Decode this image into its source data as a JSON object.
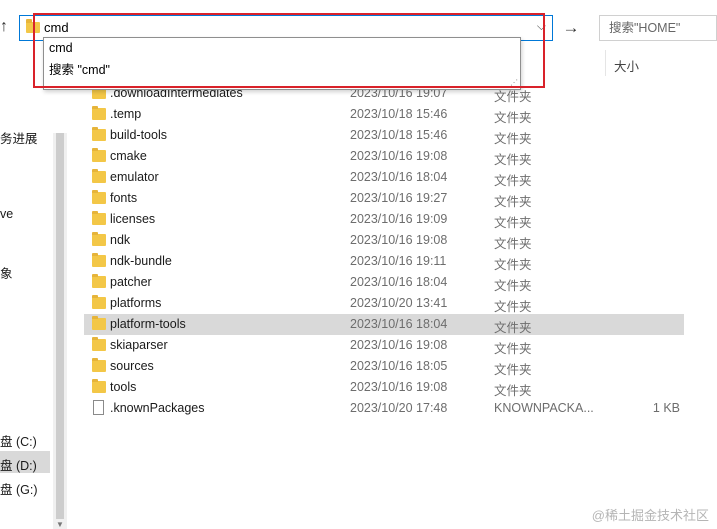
{
  "address_bar": {
    "value": "cmd",
    "go_arrow": "→",
    "up_arrow": "↑",
    "chevron": "⌵"
  },
  "search": {
    "placeholder": "搜索\"HOME\""
  },
  "autocomplete": {
    "items": [
      "cmd",
      "搜索 \"cmd\""
    ]
  },
  "columns": {
    "size": "大小"
  },
  "nav": {
    "items": [
      "务进展",
      "ve",
      "象",
      "盘 (C:)",
      "盘 (D:)",
      "盘 (G:)"
    ]
  },
  "files": [
    {
      "name": ".downloadIntermediates",
      "date": "2023/10/16 19:07",
      "type": "文件夹",
      "size": "",
      "kind": "folder"
    },
    {
      "name": ".temp",
      "date": "2023/10/18 15:46",
      "type": "文件夹",
      "size": "",
      "kind": "folder"
    },
    {
      "name": "build-tools",
      "date": "2023/10/18 15:46",
      "type": "文件夹",
      "size": "",
      "kind": "folder"
    },
    {
      "name": "cmake",
      "date": "2023/10/16 19:08",
      "type": "文件夹",
      "size": "",
      "kind": "folder"
    },
    {
      "name": "emulator",
      "date": "2023/10/16 18:04",
      "type": "文件夹",
      "size": "",
      "kind": "folder"
    },
    {
      "name": "fonts",
      "date": "2023/10/16 19:27",
      "type": "文件夹",
      "size": "",
      "kind": "folder"
    },
    {
      "name": "licenses",
      "date": "2023/10/16 19:09",
      "type": "文件夹",
      "size": "",
      "kind": "folder"
    },
    {
      "name": "ndk",
      "date": "2023/10/16 19:08",
      "type": "文件夹",
      "size": "",
      "kind": "folder"
    },
    {
      "name": "ndk-bundle",
      "date": "2023/10/16 19:11",
      "type": "文件夹",
      "size": "",
      "kind": "folder"
    },
    {
      "name": "patcher",
      "date": "2023/10/16 18:04",
      "type": "文件夹",
      "size": "",
      "kind": "folder"
    },
    {
      "name": "platforms",
      "date": "2023/10/20 13:41",
      "type": "文件夹",
      "size": "",
      "kind": "folder"
    },
    {
      "name": "platform-tools",
      "date": "2023/10/16 18:04",
      "type": "文件夹",
      "size": "",
      "kind": "folder",
      "selected": true
    },
    {
      "name": "skiaparser",
      "date": "2023/10/16 19:08",
      "type": "文件夹",
      "size": "",
      "kind": "folder"
    },
    {
      "name": "sources",
      "date": "2023/10/16 18:05",
      "type": "文件夹",
      "size": "",
      "kind": "folder"
    },
    {
      "name": "tools",
      "date": "2023/10/16 19:08",
      "type": "文件夹",
      "size": "",
      "kind": "folder"
    },
    {
      "name": ".knownPackages",
      "date": "2023/10/20 17:48",
      "type": "KNOWNPACKA...",
      "size": "1 KB",
      "kind": "file"
    }
  ],
  "watermark": "@稀土掘金技术社区",
  "colors": {
    "accent": "#0078d7",
    "highlight": "#d9222a",
    "selection": "#d9d9d9",
    "folder": "#f3c747"
  }
}
